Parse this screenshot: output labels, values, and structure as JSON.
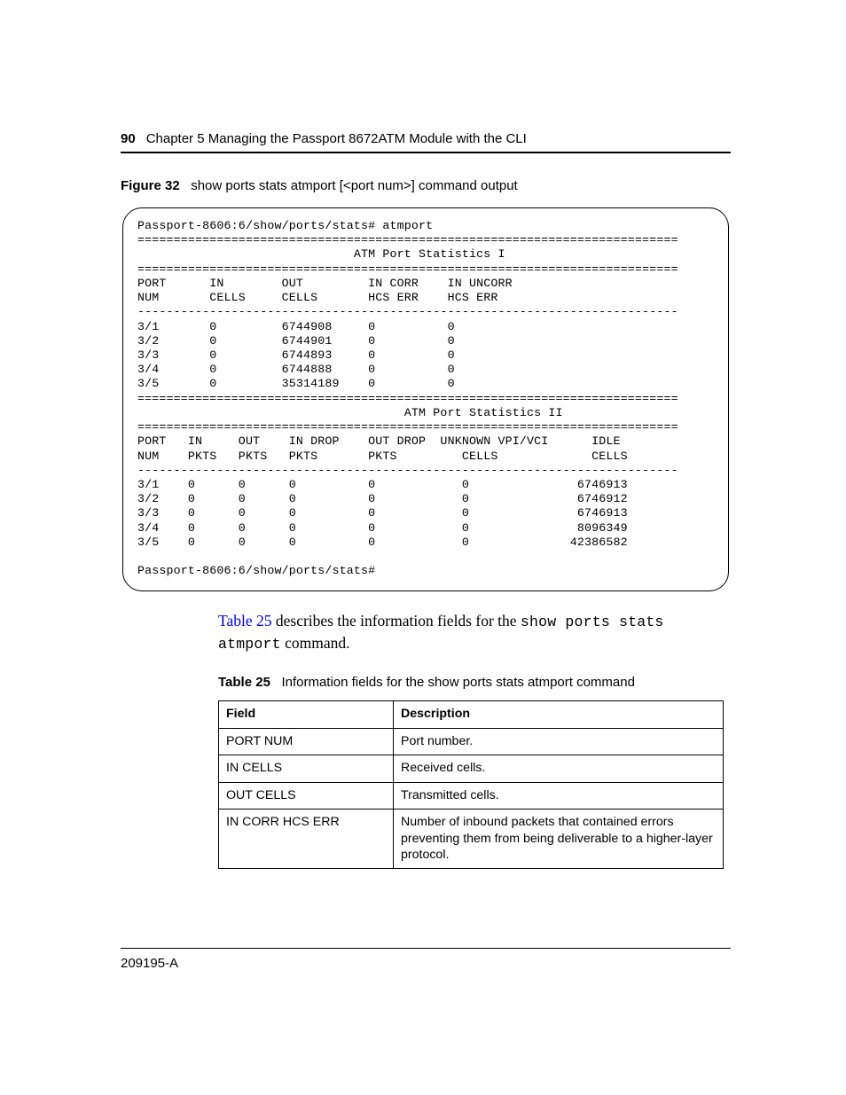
{
  "header": {
    "page_number": "90",
    "chapter": "Chapter 5  Managing the Passport 8672ATM Module with the CLI"
  },
  "figure": {
    "label": "Figure 32",
    "title": "show ports stats atmport [<port num>] command output"
  },
  "terminal": "Passport-8606:6/show/ports/stats# atmport\n===========================================================================\n                              ATM Port Statistics I\n===========================================================================\nPORT      IN        OUT         IN CORR    IN UNCORR\nNUM       CELLS     CELLS       HCS ERR    HCS ERR\n---------------------------------------------------------------------------\n3/1       0         6744908     0          0\n3/2       0         6744901     0          0\n3/3       0         6744893     0          0\n3/4       0         6744888     0          0\n3/5       0         35314189    0          0\n===========================================================================\n                                     ATM Port Statistics II\n===========================================================================\nPORT   IN     OUT    IN DROP    OUT DROP  UNKNOWN VPI/VCI      IDLE\nNUM    PKTS   PKTS   PKTS       PKTS         CELLS             CELLS\n---------------------------------------------------------------------------\n3/1    0      0      0          0            0               6746913\n3/2    0      0      0          0            0               6746912\n3/3    0      0      0          0            0               6746913\n3/4    0      0      0          0            0               8096349\n3/5    0      0      0          0            0              42386582\n\nPassport-8606:6/show/ports/stats#",
  "paragraph": {
    "link_text": "Table 25",
    "rest1": " describes the information fields for the ",
    "mono": "show ports stats atmport",
    "rest2": " command."
  },
  "table_caption": {
    "label": "Table 25",
    "title": "Information fields for the show ports stats atmport command"
  },
  "table": {
    "headers": {
      "field": "Field",
      "desc": "Description"
    },
    "rows": [
      {
        "field": "PORT NUM",
        "desc": "Port number."
      },
      {
        "field": "IN CELLS",
        "desc": "Received cells."
      },
      {
        "field": "OUT CELLS",
        "desc": "Transmitted cells."
      },
      {
        "field": "IN CORR HCS ERR",
        "desc": "Number of inbound packets that contained errors preventing them from being deliverable to a higher-layer protocol."
      }
    ]
  },
  "footer": "209195-A"
}
